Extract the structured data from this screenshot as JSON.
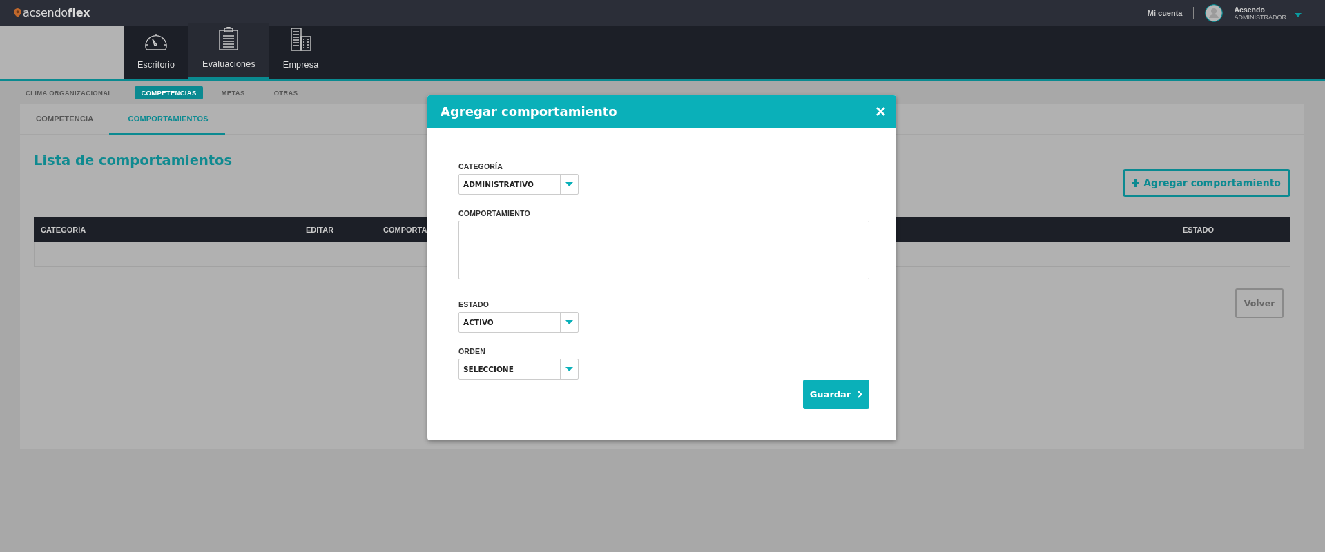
{
  "brand": "acsendo**flex**",
  "account": {
    "link": "Mi cuenta",
    "user_name": "Acsendo",
    "user_role": "ADMINISTRADOR"
  },
  "modules": [
    {
      "label": "Escritorio",
      "kind": "gauge",
      "selected": false
    },
    {
      "label": "Evaluaciones",
      "kind": "clipboard",
      "selected": true
    },
    {
      "label": "Empresa",
      "kind": "building",
      "selected": false
    }
  ],
  "subnav": [
    {
      "label": "CLIMA ORGANIZACIONAL",
      "selected": false
    },
    {
      "label": "COMPETENCIAS",
      "selected": true
    },
    {
      "label": "METAS",
      "selected": false
    },
    {
      "label": "OTRAS",
      "selected": false
    }
  ],
  "tabs": [
    {
      "label": "COMPETENCIA",
      "selected": false
    },
    {
      "label": "COMPORTAMIENTOS",
      "selected": true
    }
  ],
  "page_title": "Lista de comportamientos",
  "add_button": "Agregar comportamiento",
  "table": {
    "columns": [
      "CATEGORÍA",
      "EDITAR",
      "COMPORTA",
      "ESTADO"
    ]
  },
  "back_button": "Volver",
  "modal": {
    "title": "Agregar comportamiento",
    "fields": [
      {
        "kind": "select",
        "label": "CATEGORÍA",
        "value": "ADMINISTRATIVO"
      },
      {
        "kind": "textarea",
        "label": "COMPORTAMIENTO"
      },
      {
        "kind": "select",
        "label": "ESTADO",
        "value": "ACTIVO"
      },
      {
        "kind": "select",
        "label": "ORDEN",
        "value": "SELECCIONE"
      }
    ],
    "submit": "Guardar"
  }
}
